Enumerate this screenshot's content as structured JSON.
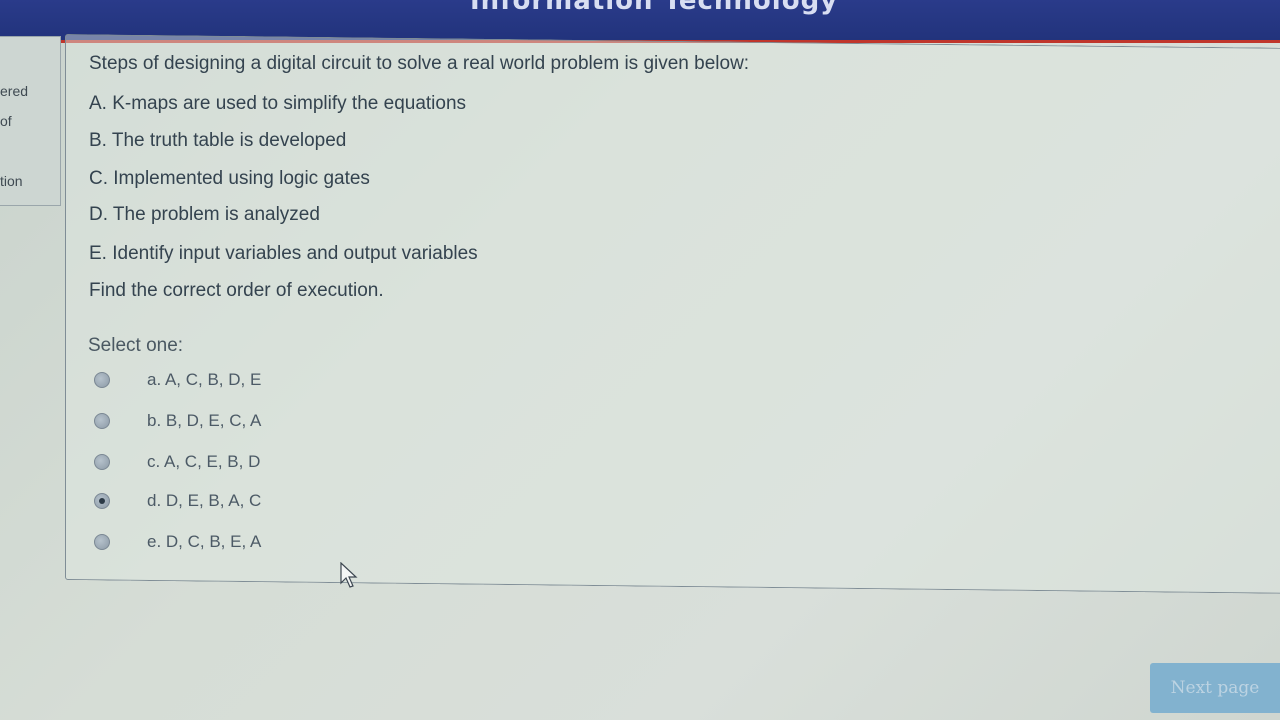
{
  "header": {
    "title": "Information Technology"
  },
  "sidebar": {
    "labels": [
      "ered",
      "of",
      "tion"
    ]
  },
  "question": {
    "intro": "Steps of designing a digital circuit to solve a real world problem is given below:",
    "steps": [
      "A. K-maps are used to simplify the equations",
      "B. The truth table is developed",
      "C. Implemented using logic gates",
      "D. The problem is analyzed",
      "E. Identify input variables and output variables"
    ],
    "prompt": "Find the correct order of execution.",
    "select_label": "Select one:",
    "options": [
      {
        "label": "a. A, C, B, D, E",
        "selected": false
      },
      {
        "label": "b. B, D, E, C, A",
        "selected": false
      },
      {
        "label": "c. A, C, E, B, D",
        "selected": false
      },
      {
        "label": "d. D, E, B, A, C",
        "selected": true
      },
      {
        "label": "e. D, C, B, E, A",
        "selected": false
      }
    ]
  },
  "navigation": {
    "next_label": "Next page"
  },
  "colors": {
    "header": "#22337c",
    "header_border": "#c0362c",
    "next_button": "#82b2cf"
  }
}
